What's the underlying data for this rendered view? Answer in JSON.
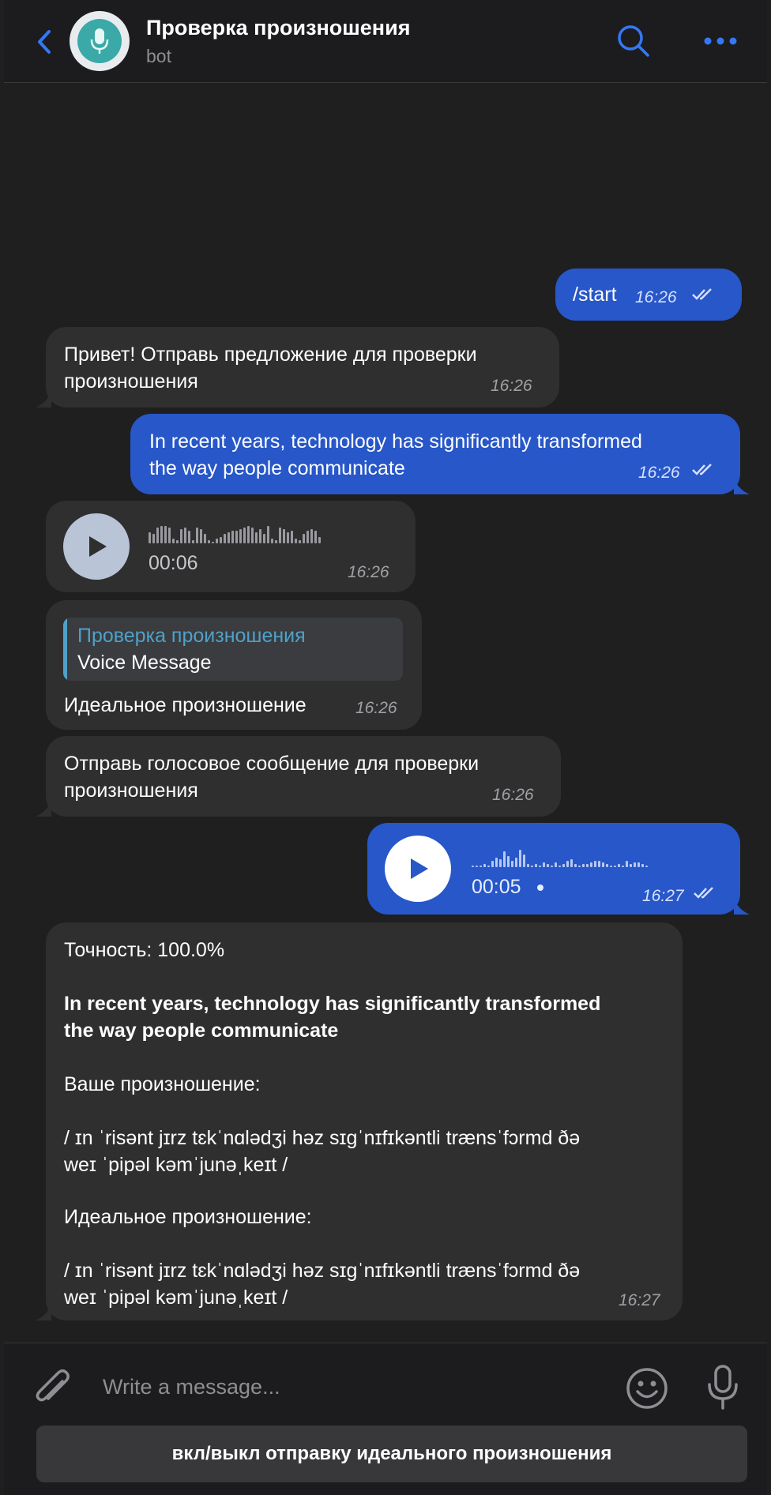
{
  "header": {
    "title": "Проверка произношения",
    "subtitle": "bot"
  },
  "messages": {
    "start": {
      "text": "/start",
      "time": "16:26"
    },
    "greeting": {
      "line1": "Привет! Отправь предложение для проверки",
      "line2": "произношения",
      "time": "16:26"
    },
    "sentence": {
      "line1": "In recent years, technology has significantly transformed",
      "line2": "the way people communicate",
      "time": "16:26"
    },
    "voice_in": {
      "duration": "00:06",
      "time": "16:26"
    },
    "reply": {
      "quote_title": "Проверка произношения",
      "quote_text": "Voice Message",
      "text": "Идеальное произношение",
      "time": "16:26"
    },
    "prompt": {
      "line1": "Отправь голосовое сообщение для проверки",
      "line2": "произношения",
      "time": "16:26"
    },
    "voice_out": {
      "duration": "00:05",
      "time": "16:27"
    },
    "result": {
      "accuracy": "Точность: 100.0%",
      "sentence_line1": "In recent years, technology has significantly transformed",
      "sentence_line2": "the way people communicate",
      "yours_label": "Ваше произношение:",
      "yours_line1": "/ ɪn ˈrisənt jɪrz tɛkˈnɑlədʒi həz sɪɡˈnɪfɪkəntli trænsˈfɔrmd ðə",
      "yours_line2": "weɪ ˈpipəl kəmˈjunəˌkeɪt /",
      "ideal_label": "Идеальное произношение:",
      "ideal_line1": "/ ɪn ˈrisənt jɪrz tɛkˈnɑlədʒi həz sɪɡˈnɪfɪkəntli trænsˈfɔrmd ðə",
      "ideal_line2": "weɪ ˈpipəl kəmˈjunəˌkeɪt /",
      "time": "16:27"
    }
  },
  "composer": {
    "placeholder": "Write a message...",
    "keyboard_button": "вкл/выкл отправку идеального произношения"
  },
  "colors": {
    "accent": "#2757c8",
    "incoming": "#2f2f30",
    "background": "#1f1f1f",
    "link": "#4fa1c9"
  },
  "icons": [
    "chevron-left-icon",
    "bot-avatar-icon",
    "search-icon",
    "more-icon",
    "play-icon",
    "double-check-icon",
    "paperclip-icon",
    "emoji-icon",
    "microphone-icon"
  ]
}
